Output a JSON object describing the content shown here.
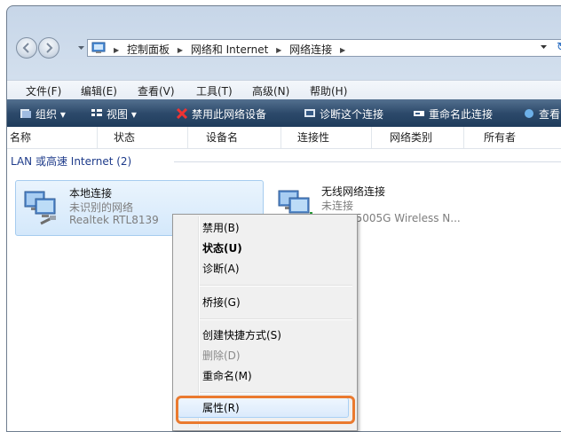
{
  "address_bar": {
    "crumbs": [
      "控制面板",
      "网络和 Internet",
      "网络连接"
    ],
    "refresh_glyph": "↻"
  },
  "menu": [
    "文件(F)",
    "编辑(E)",
    "查看(V)",
    "工具(T)",
    "高级(N)",
    "帮助(H)"
  ],
  "commands": [
    "组织 ▾",
    "视图 ▾",
    "禁用此网络设备",
    "诊断这个连接",
    "重命名此连接",
    "查看"
  ],
  "columns": [
    "名称",
    "状态",
    "设备名",
    "连接性",
    "网络类别",
    "所有者"
  ],
  "group": {
    "label": "LAN 或高速 Internet (2)"
  },
  "items": [
    {
      "name": "本地连接",
      "status": "未识别的网络",
      "device": "Realtek RTL8139"
    },
    {
      "name": "无线网络连接",
      "status": "未连接",
      "device": "ros AR5005G Wireless N..."
    }
  ],
  "context_menu": [
    {
      "label": "禁用(B)",
      "style": "normal"
    },
    {
      "label": "状态(U)",
      "style": "bold"
    },
    {
      "label": "诊断(A)",
      "style": "normal"
    },
    {
      "label": "桥接(G)",
      "style": "normal"
    },
    {
      "label": "创建快捷方式(S)",
      "style": "normal"
    },
    {
      "label": "删除(D)",
      "style": "disabled"
    },
    {
      "label": "重命名(M)",
      "style": "normal"
    },
    {
      "label": "属性(R)",
      "style": "highlighted"
    }
  ],
  "colors": {
    "command_bar": "#2d4a6b",
    "highlight": "#ea7a2f",
    "group_text": "#1e3b8a"
  },
  "icons": [
    "back-arrow-icon",
    "forward-arrow-icon",
    "control-panel-icon",
    "network-connection-icon",
    "refresh-icon"
  ]
}
